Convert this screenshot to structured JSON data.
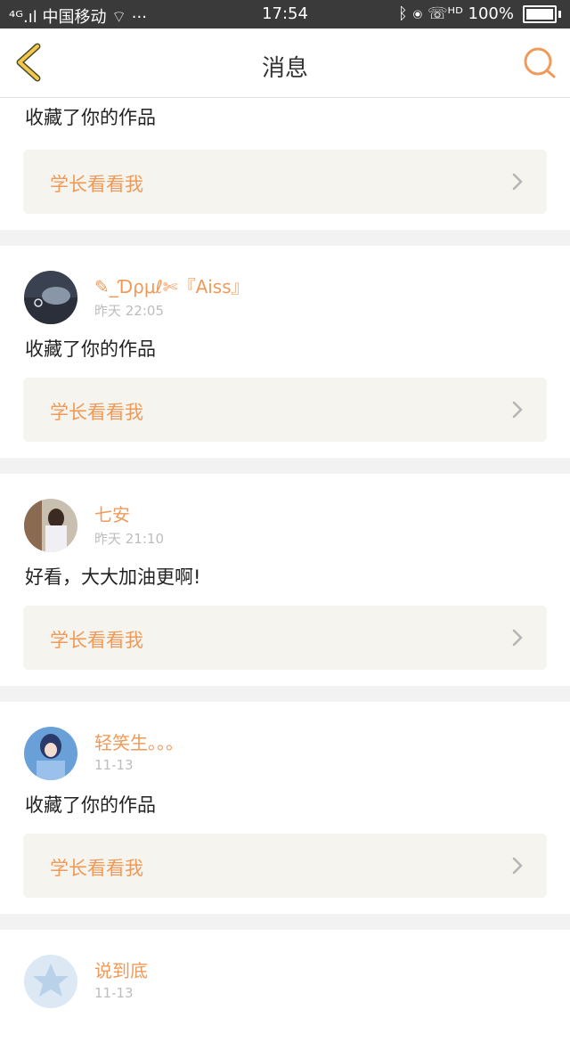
{
  "status_bar": {
    "carrier": "⁴ᴳ.ıl 中国移动 ⌔ ···",
    "time": "17:54",
    "right": "ᛒ ⦿ ☏ᴴᴰ 100%"
  },
  "nav": {
    "title": "消息",
    "back_icon": "chevron-left-icon",
    "search_icon": "search-icon"
  },
  "colors": {
    "accent": "#f09a5a",
    "back_icon": "#f2c94c",
    "link_bg": "#f5f4ee"
  },
  "items": [
    {
      "content": "收藏了你的作品",
      "link_label": "学长看看我"
    },
    {
      "username": "✎_Ɗρμℓ✄『Aiss』",
      "time": "昨天 22:05",
      "content": "收藏了你的作品",
      "link_label": "学长看看我"
    },
    {
      "username": "七安",
      "time": "昨天 21:10",
      "content": "好看，大大加油更啊!",
      "link_label": "学长看看我"
    },
    {
      "username": "轻笑生。。。",
      "time": "11-13",
      "content": "收藏了你的作品",
      "link_label": "学长看看我"
    },
    {
      "username": "说到底",
      "time": "11-13"
    }
  ]
}
